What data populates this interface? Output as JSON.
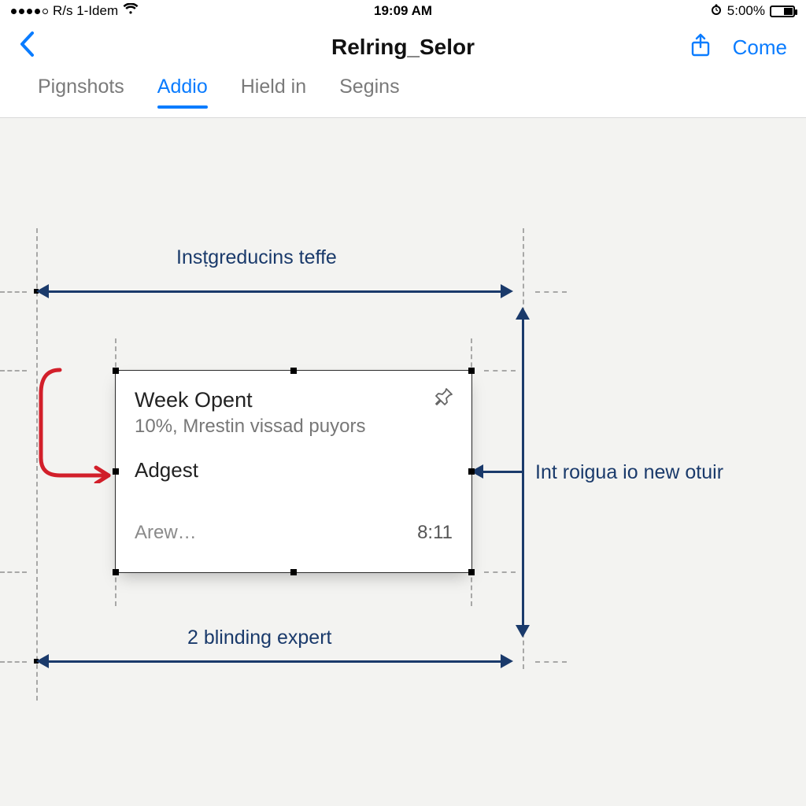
{
  "status": {
    "carrier": "R/s 1-Idem",
    "time": "19:09 AM",
    "battery_text": "5:00%",
    "alarm": "⏰"
  },
  "nav": {
    "title": "Relring_Selor",
    "action_label": "Come"
  },
  "tabs": [
    "Pignshots",
    "Addio",
    "Hield in",
    "Segins"
  ],
  "tabs_active_index": 1,
  "annotations": {
    "top": "Insṭgreducins teffe",
    "right": "Int roigua io new otuir",
    "bottom": "2 blinding expert"
  },
  "card": {
    "title": "Week Opent",
    "subtitle": "10%, Mrestin vissad puyors",
    "row2": "Adgest",
    "footer_left": "Arew…",
    "footer_right": "8:11"
  },
  "colors": {
    "accent": "#0a7cff",
    "dim_line": "#1a3a6b",
    "red": "#d21f2a"
  }
}
